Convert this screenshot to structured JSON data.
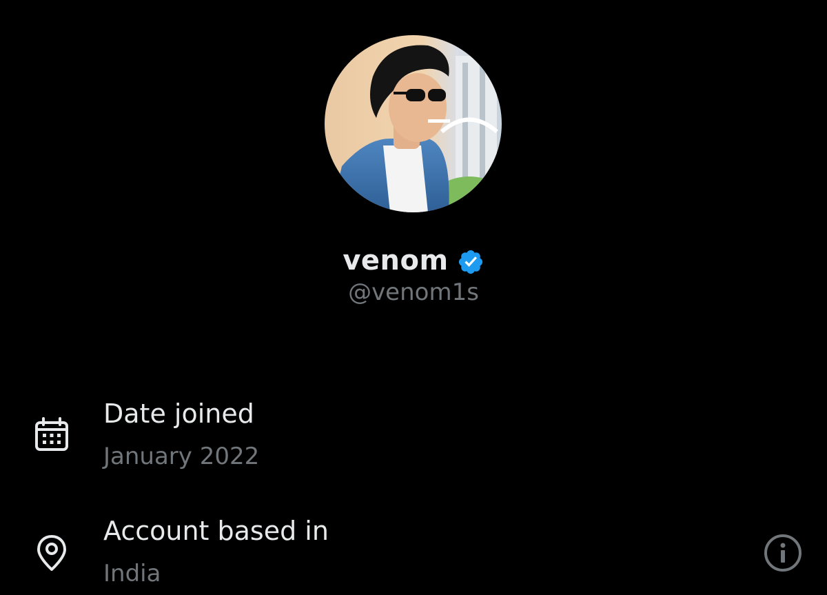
{
  "profile": {
    "display_name": "venom",
    "handle": "@venom1s",
    "verified": true,
    "avatar_icon": "profile-photo"
  },
  "details": {
    "date_joined": {
      "label": "Date joined",
      "value": "January 2022",
      "icon": "calendar-icon"
    },
    "account_based_in": {
      "label": "Account based in",
      "value": "India",
      "icon": "location-pin-icon",
      "action_icon": "info-icon"
    }
  },
  "colors": {
    "background": "#000000",
    "primary_text": "#e7e9ea",
    "secondary_text": "#71767b",
    "verified_blue": "#1d9bf0"
  }
}
